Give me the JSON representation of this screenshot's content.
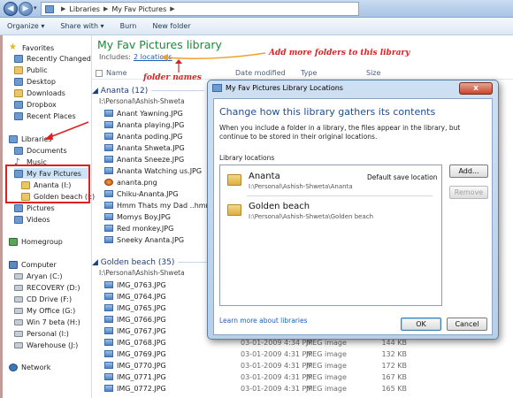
{
  "address": {
    "crumbs": [
      "Libraries",
      "My Fav Pictures"
    ]
  },
  "toolbar": {
    "organize": "Organize ▾",
    "share": "Share with ▾",
    "burn": "Burn",
    "new_folder": "New folder"
  },
  "nav": {
    "favorites": "Favorites",
    "recent": "Recently Changed",
    "public": "Public",
    "desktop": "Desktop",
    "downloads": "Downloads",
    "dropbox": "Dropbox",
    "recent_places": "Recent Places",
    "libraries": "Libraries",
    "documents": "Documents",
    "music": "Music",
    "my_fav": "My Fav Pictures",
    "ananta": "Ananta (I:)",
    "golden": "Golden beach (I:)",
    "pictures": "Pictures",
    "videos": "Videos",
    "homegroup": "Homegroup",
    "computer": "Computer",
    "drives": [
      "Aryan (C:)",
      "RECOVERY (D:)",
      "CD Drive (F:)",
      "My Office (G:)",
      "Win 7 beta (H:)",
      "Personal (I:)",
      "Warehouse (J:)"
    ],
    "network": "Network"
  },
  "library": {
    "title": "My Fav Pictures library",
    "includes_label": "Includes:",
    "includes_link": "2 locations"
  },
  "columns": {
    "name": "Name",
    "date": "Date modified",
    "type": "Type",
    "size": "Size"
  },
  "groups": [
    {
      "title": "Ananta (12)",
      "path": "I:\\Personal\\Ashish-Shweta",
      "files": [
        {
          "name": "Anant Yawning.JPG"
        },
        {
          "name": "Ananta playing.JPG"
        },
        {
          "name": "Ananta poding.JPG"
        },
        {
          "name": "Ananta Shweta.JPG"
        },
        {
          "name": "Ananta Sneeze.JPG"
        },
        {
          "name": "Ananta Watching us.JPG"
        },
        {
          "name": "ananta.png"
        },
        {
          "name": "Chiku-Ananta.JPG"
        },
        {
          "name": "Hmm Thats my Dad ..hmmm.JPG"
        },
        {
          "name": "Momys Boy.JPG"
        },
        {
          "name": "Red monkey.JPG"
        },
        {
          "name": "Sneeky Ananta.JPG"
        }
      ]
    },
    {
      "title": "Golden beach (35)",
      "path": "I:\\Personal\\Ashish-Shweta",
      "files": [
        {
          "name": "IMG_0763.JPG",
          "date": "",
          "type": "",
          "size": ""
        },
        {
          "name": "IMG_0764.JPG",
          "date": "",
          "type": "",
          "size": ""
        },
        {
          "name": "IMG_0765.JPG",
          "date": "",
          "type": "",
          "size": ""
        },
        {
          "name": "IMG_0766.JPG",
          "date": "",
          "type": "",
          "size": ""
        },
        {
          "name": "IMG_0767.JPG",
          "date": "",
          "type": "",
          "size": ""
        },
        {
          "name": "IMG_0768.JPG",
          "date": "03-01-2009 4:34 PM",
          "type": "JPEG image",
          "size": "144 KB"
        },
        {
          "name": "IMG_0769.JPG",
          "date": "03-01-2009 4:31 PM",
          "type": "JPEG image",
          "size": "132 KB"
        },
        {
          "name": "IMG_0770.JPG",
          "date": "03-01-2009 4:31 PM",
          "type": "JPEG image",
          "size": "172 KB"
        },
        {
          "name": "IMG_0771.JPG",
          "date": "03-01-2009 4:31 PM",
          "type": "JPEG image",
          "size": "167 KB"
        },
        {
          "name": "IMG_0772.JPG",
          "date": "03-01-2009 4:31 PM",
          "type": "JPEG image",
          "size": "165 KB"
        }
      ]
    }
  ],
  "annotations": {
    "add_more": "Add more folders to this library",
    "folder_names": "folder names"
  },
  "dialog": {
    "title": "My Fav Pictures Library Locations",
    "heading": "Change how this library gathers its contents",
    "description": "When you include a folder in a library, the files appear in the library, but continue to be stored in their original locations.",
    "locations_label": "Library locations",
    "locations": [
      {
        "name": "Ananta",
        "path": "I:\\Personal\\Ashish-Shweta\\Ananta",
        "note": "Default save location"
      },
      {
        "name": "Golden beach",
        "path": "I:\\Personal\\Ashish-Shweta\\Golden beach",
        "note": ""
      }
    ],
    "add_label": "Add...",
    "remove_label": "Remove",
    "learn_more": "Learn more about libraries",
    "ok_label": "OK",
    "cancel_label": "Cancel",
    "close_glyph": "x"
  },
  "colors": {
    "title_green": "#1a8c3a",
    "annotation_red": "#e02020",
    "link_blue": "#1c5fb8"
  }
}
